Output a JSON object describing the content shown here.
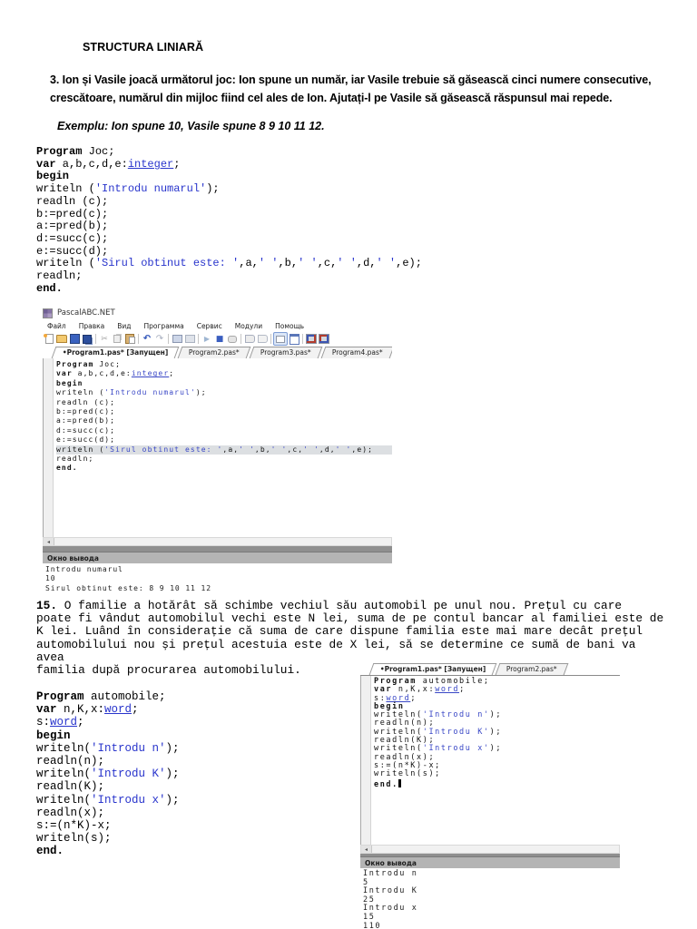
{
  "document": {
    "heading": "STRUCTURA LINIARĂ",
    "problem3": "3. Ion și Vasile joacă următorul joc: Ion spune un număr, iar Vasile trebuie să găsească cinci numere consecutive,\ncrescătoare, numărul din mijloc fiind cel ales de Ion. Ajutați-l pe Vasile să găsească răspunsul mai repede.",
    "example": "Exemplu: Ion spune 10, Vasile spune 8 9 10 11 12.",
    "problem15_number": "15.",
    "problem15_text": " O familie a hotărât să schimbe vechiul său automobil pe unul nou. Prețul cu care\npoate fi vândut automobilul vechi este N lei, suma de pe contul bancar al familiei este de\nK lei. Luând în considerație că suma de care dispune familia este mai mare decât prețul\nautomobilului nou și prețul acestuia este de X lei, să se determine ce sumă de bani va\navea\nfamilia după procurarea automobilului."
  },
  "syntax_colors": {
    "keyword": "#000000",
    "string": "#2834cc",
    "type": "#2834cc"
  },
  "listing_joc": {
    "lines": [
      [
        [
          "k",
          "Program"
        ],
        [
          "p",
          " Joc;"
        ]
      ],
      [
        [
          "k",
          "var"
        ],
        [
          "p",
          " a,b,c,d,e:"
        ],
        [
          "t",
          "integer"
        ],
        [
          "p",
          ";"
        ]
      ],
      [
        [
          "k",
          "begin"
        ]
      ],
      [
        [
          "p",
          "writeln ("
        ],
        [
          "s",
          "'Introdu numarul'"
        ],
        [
          "p",
          ");"
        ]
      ],
      [
        [
          "p",
          "readln (c);"
        ]
      ],
      [
        [
          "p",
          "b:=pred(c);"
        ]
      ],
      [
        [
          "p",
          "a:=pred(b);"
        ]
      ],
      [
        [
          "p",
          "d:=succ(c);"
        ]
      ],
      [
        [
          "p",
          "e:=succ(d);"
        ]
      ],
      [
        [
          "p",
          "writeln ("
        ],
        [
          "s",
          "'Sirul obtinut este: '"
        ],
        [
          "p",
          ",a,"
        ],
        [
          "s",
          "' '"
        ],
        [
          "p",
          ",b,"
        ],
        [
          "s",
          "' '"
        ],
        [
          "p",
          ",c,"
        ],
        [
          "s",
          "' '"
        ],
        [
          "p",
          ",d,"
        ],
        [
          "s",
          "' '"
        ],
        [
          "p",
          ",e);"
        ]
      ],
      [
        [
          "p",
          "readln;"
        ]
      ],
      [
        [
          "k",
          "end."
        ]
      ]
    ]
  },
  "listing_automobile": {
    "lines": [
      [
        [
          "k",
          "Program"
        ],
        [
          "p",
          " automobile;"
        ]
      ],
      [
        [
          "k",
          "var"
        ],
        [
          "p",
          " n,K,x:"
        ],
        [
          "t",
          "word"
        ],
        [
          "p",
          ";"
        ]
      ],
      [
        [
          "p",
          "s:"
        ],
        [
          "t",
          "word"
        ],
        [
          "p",
          ";"
        ]
      ],
      [
        [
          "k",
          "begin"
        ]
      ],
      [
        [
          "p",
          "writeln("
        ],
        [
          "s",
          "'Introdu n'"
        ],
        [
          "p",
          ");"
        ]
      ],
      [
        [
          "p",
          "readln(n);"
        ]
      ],
      [
        [
          "p",
          "writeln("
        ],
        [
          "s",
          "'Introdu K'"
        ],
        [
          "p",
          ");"
        ]
      ],
      [
        [
          "p",
          "readln(K);"
        ]
      ],
      [
        [
          "p",
          "writeln("
        ],
        [
          "s",
          "'Introdu x'"
        ],
        [
          "p",
          ");"
        ]
      ],
      [
        [
          "p",
          "readln(x);"
        ]
      ],
      [
        [
          "p",
          "s:=(n*K)-x;"
        ]
      ],
      [
        [
          "p",
          "writeln(s);"
        ]
      ],
      [
        [
          "k",
          "end."
        ]
      ]
    ]
  },
  "ide1": {
    "window_title": "PascalABC.NET",
    "menu": [
      "Файл",
      "Правка",
      "Вид",
      "Программа",
      "Сервис",
      "Модули",
      "Помощь"
    ],
    "toolbar": [
      "new-file",
      "open-folder",
      "save",
      "save-all",
      "sep",
      "cut",
      "copy",
      "paste",
      "sep",
      "undo",
      "redo",
      "sep",
      "compile",
      "build",
      "sep",
      "run",
      "stop",
      "find-in-code",
      "sep",
      "step-over",
      "step-into",
      "sep",
      "console-toggle",
      "form-view",
      "sep",
      "convert-left",
      "convert-right"
    ],
    "tabs": [
      {
        "label": "•Program1.pas* [Запущен]",
        "active": true
      },
      {
        "label": "Program2.pas*",
        "active": false
      },
      {
        "label": "Program3.pas*",
        "active": false
      },
      {
        "label": "Program4.pas*",
        "active": false
      }
    ],
    "code": {
      "highlight_line": 9,
      "lines": [
        [
          [
            "k",
            "Program"
          ],
          [
            "p",
            " Joc;"
          ]
        ],
        [
          [
            "k",
            "var"
          ],
          [
            "p",
            " a,b,c,d,e:"
          ],
          [
            "t",
            "integer"
          ],
          [
            "p",
            ";"
          ]
        ],
        [
          [
            "k",
            "begin"
          ]
        ],
        [
          [
            "p",
            "writeln ("
          ],
          [
            "s",
            "'Introdu numarul'"
          ],
          [
            "p",
            ");"
          ]
        ],
        [
          [
            "p",
            "readln (c);"
          ]
        ],
        [
          [
            "p",
            "b:=pred(c);"
          ]
        ],
        [
          [
            "p",
            "a:=pred(b);"
          ]
        ],
        [
          [
            "p",
            "d:=succ(c);"
          ]
        ],
        [
          [
            "p",
            "e:=succ(d);"
          ]
        ],
        [
          [
            "p",
            "writeln ("
          ],
          [
            "s",
            "'Sirul obtinut este: '"
          ],
          [
            "p",
            ",a,"
          ],
          [
            "s",
            "' '"
          ],
          [
            "p",
            ",b,"
          ],
          [
            "s",
            "' '"
          ],
          [
            "p",
            ",c,"
          ],
          [
            "s",
            "' '"
          ],
          [
            "p",
            ",d,"
          ],
          [
            "s",
            "' '"
          ],
          [
            "p",
            ",e);"
          ]
        ],
        [
          [
            "p",
            "readln;"
          ]
        ],
        [
          [
            "k",
            "end."
          ]
        ]
      ]
    },
    "output_title": "Окно вывода",
    "output_text": "Introdu numarul\n10\nSirul obtinut este: 8 9 10 11 12"
  },
  "ide2": {
    "tabs": [
      {
        "label": "•Program1.pas* [Запущен]",
        "active": true
      },
      {
        "label": "Program2.pas*",
        "active": false
      }
    ],
    "code": {
      "cursor_line": 12,
      "lines": [
        [
          [
            "k",
            "Program"
          ],
          [
            "p",
            " automobile;"
          ]
        ],
        [
          [
            "k",
            "var"
          ],
          [
            "p",
            " n,K,x:"
          ],
          [
            "t",
            "word"
          ],
          [
            "p",
            ";"
          ]
        ],
        [
          [
            "p",
            "s:"
          ],
          [
            "t",
            "word"
          ],
          [
            "p",
            ";"
          ]
        ],
        [
          [
            "k",
            "begin"
          ]
        ],
        [
          [
            "p",
            "writeln("
          ],
          [
            "s",
            "'Introdu n'"
          ],
          [
            "p",
            ");"
          ]
        ],
        [
          [
            "p",
            "readln(n);"
          ]
        ],
        [
          [
            "p",
            "writeln("
          ],
          [
            "s",
            "'Introdu K'"
          ],
          [
            "p",
            ");"
          ]
        ],
        [
          [
            "p",
            "readln(K);"
          ]
        ],
        [
          [
            "p",
            "writeln("
          ],
          [
            "s",
            "'Introdu x'"
          ],
          [
            "p",
            ");"
          ]
        ],
        [
          [
            "p",
            "readln(x);"
          ]
        ],
        [
          [
            "p",
            "s:=(n*K)-x;"
          ]
        ],
        [
          [
            "p",
            "writeln(s);"
          ]
        ],
        [
          [
            "k",
            "end."
          ]
        ]
      ]
    },
    "output_title": "Окно вывода",
    "output_text": "Introdu n\n5\nIntrodu K\n25\nIntrodu x\n15\n110"
  }
}
